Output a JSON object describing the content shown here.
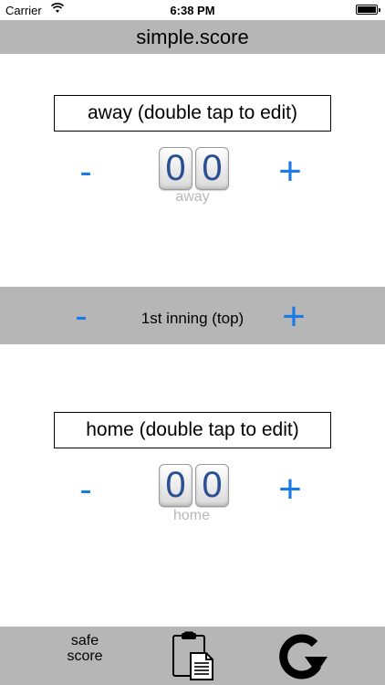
{
  "status_bar": {
    "carrier": "Carrier",
    "time": "6:38 PM",
    "wifi_icon": "wifi-icon",
    "battery_icon": "battery-icon"
  },
  "app": {
    "title": "simple.score"
  },
  "away": {
    "name_label": "away (double tap to edit)",
    "score_digits": [
      "0",
      "0"
    ],
    "tile_label": "away",
    "minus": "-",
    "plus": "+"
  },
  "inning": {
    "label": "1st inning (top)",
    "minus": "-",
    "plus": "+"
  },
  "home": {
    "name_label": "home (double tap to edit)",
    "score_digits": [
      "0",
      "0"
    ],
    "tile_label": "home",
    "minus": "-",
    "plus": "+"
  },
  "toolbar": {
    "safe_score_label_line1": "safe",
    "safe_score_label_line2": "score",
    "clipboard_icon": "clipboard-icon",
    "refresh_icon": "refresh-icon"
  },
  "colors": {
    "accent": "#1a7ae6",
    "bar_gray": "#b6b6b6",
    "digit_blue": "#2a4f93",
    "label_gray": "#b8b8b8"
  }
}
